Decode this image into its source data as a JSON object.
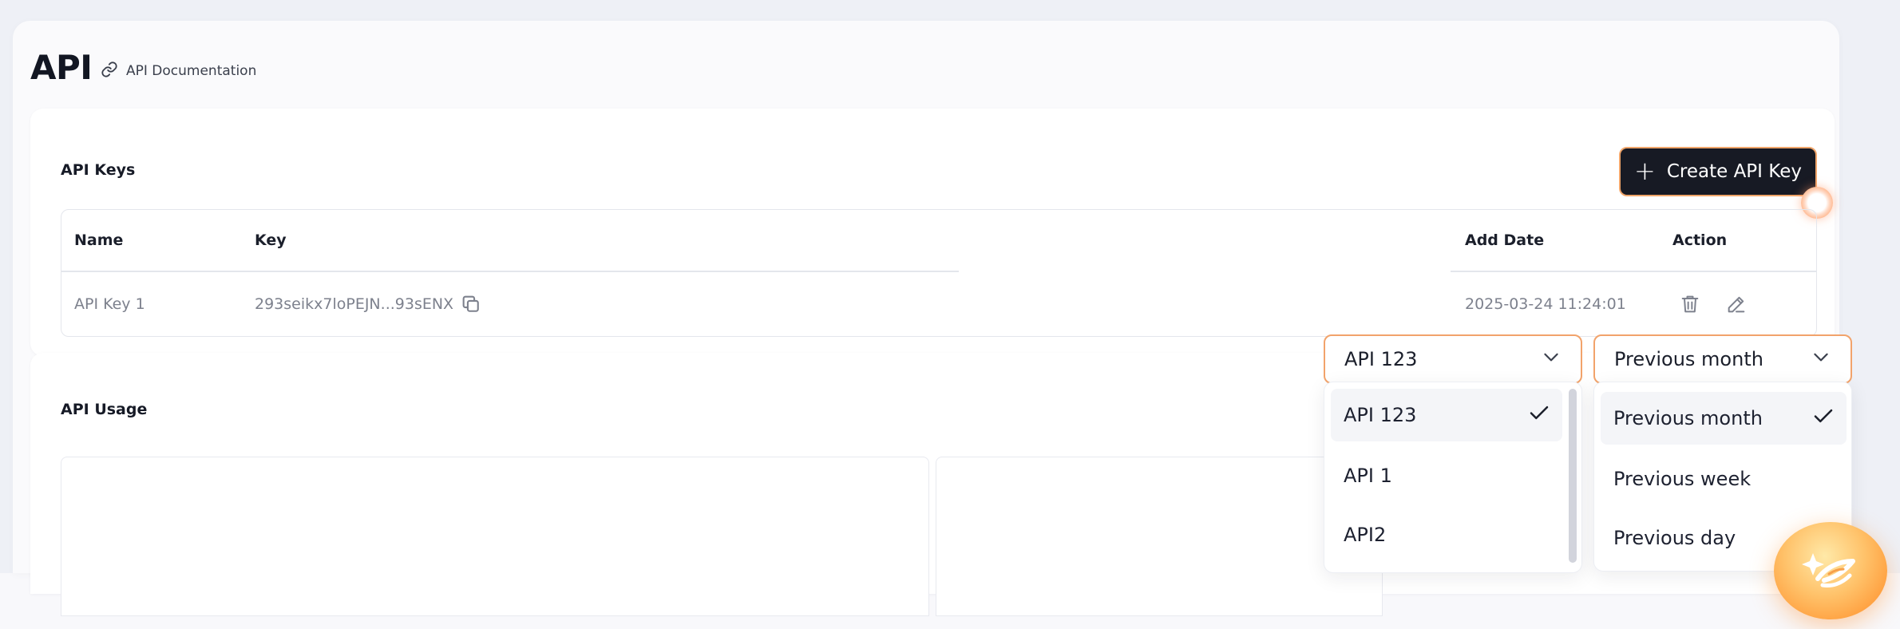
{
  "header": {
    "title": "API",
    "doc_link_label": "API Documentation"
  },
  "keys_panel": {
    "title": "API Keys",
    "create_button_label": "Create API Key",
    "table": {
      "columns": [
        "Name",
        "Key",
        "Add Date",
        "Action"
      ],
      "rows": [
        {
          "name": "API Key 1",
          "key": "293seikx7loPEJN...93sENX",
          "add_date": "2025-03-24 11:24:01"
        }
      ]
    }
  },
  "usage_panel": {
    "title": "API Usage"
  },
  "api_select": {
    "value": "API 123",
    "options": [
      "API 123",
      "API 1",
      "API2"
    ],
    "selected_index": 0
  },
  "period_select": {
    "value": "Previous month",
    "options": [
      "Previous month",
      "Previous week",
      "Previous day"
    ],
    "selected_index": 0
  },
  "icons": {
    "doc_link": "link-icon",
    "copy": "copy-icon",
    "delete": "trash-icon",
    "edit": "pencil-icon",
    "select": "chevron-down-icon",
    "selected": "checkmark-icon",
    "assistant": "assistant-logo-icon"
  },
  "colors": {
    "accent_orange": "#f2a36b",
    "button_dark": "#171a24",
    "page_bg": "#eef0f6"
  }
}
